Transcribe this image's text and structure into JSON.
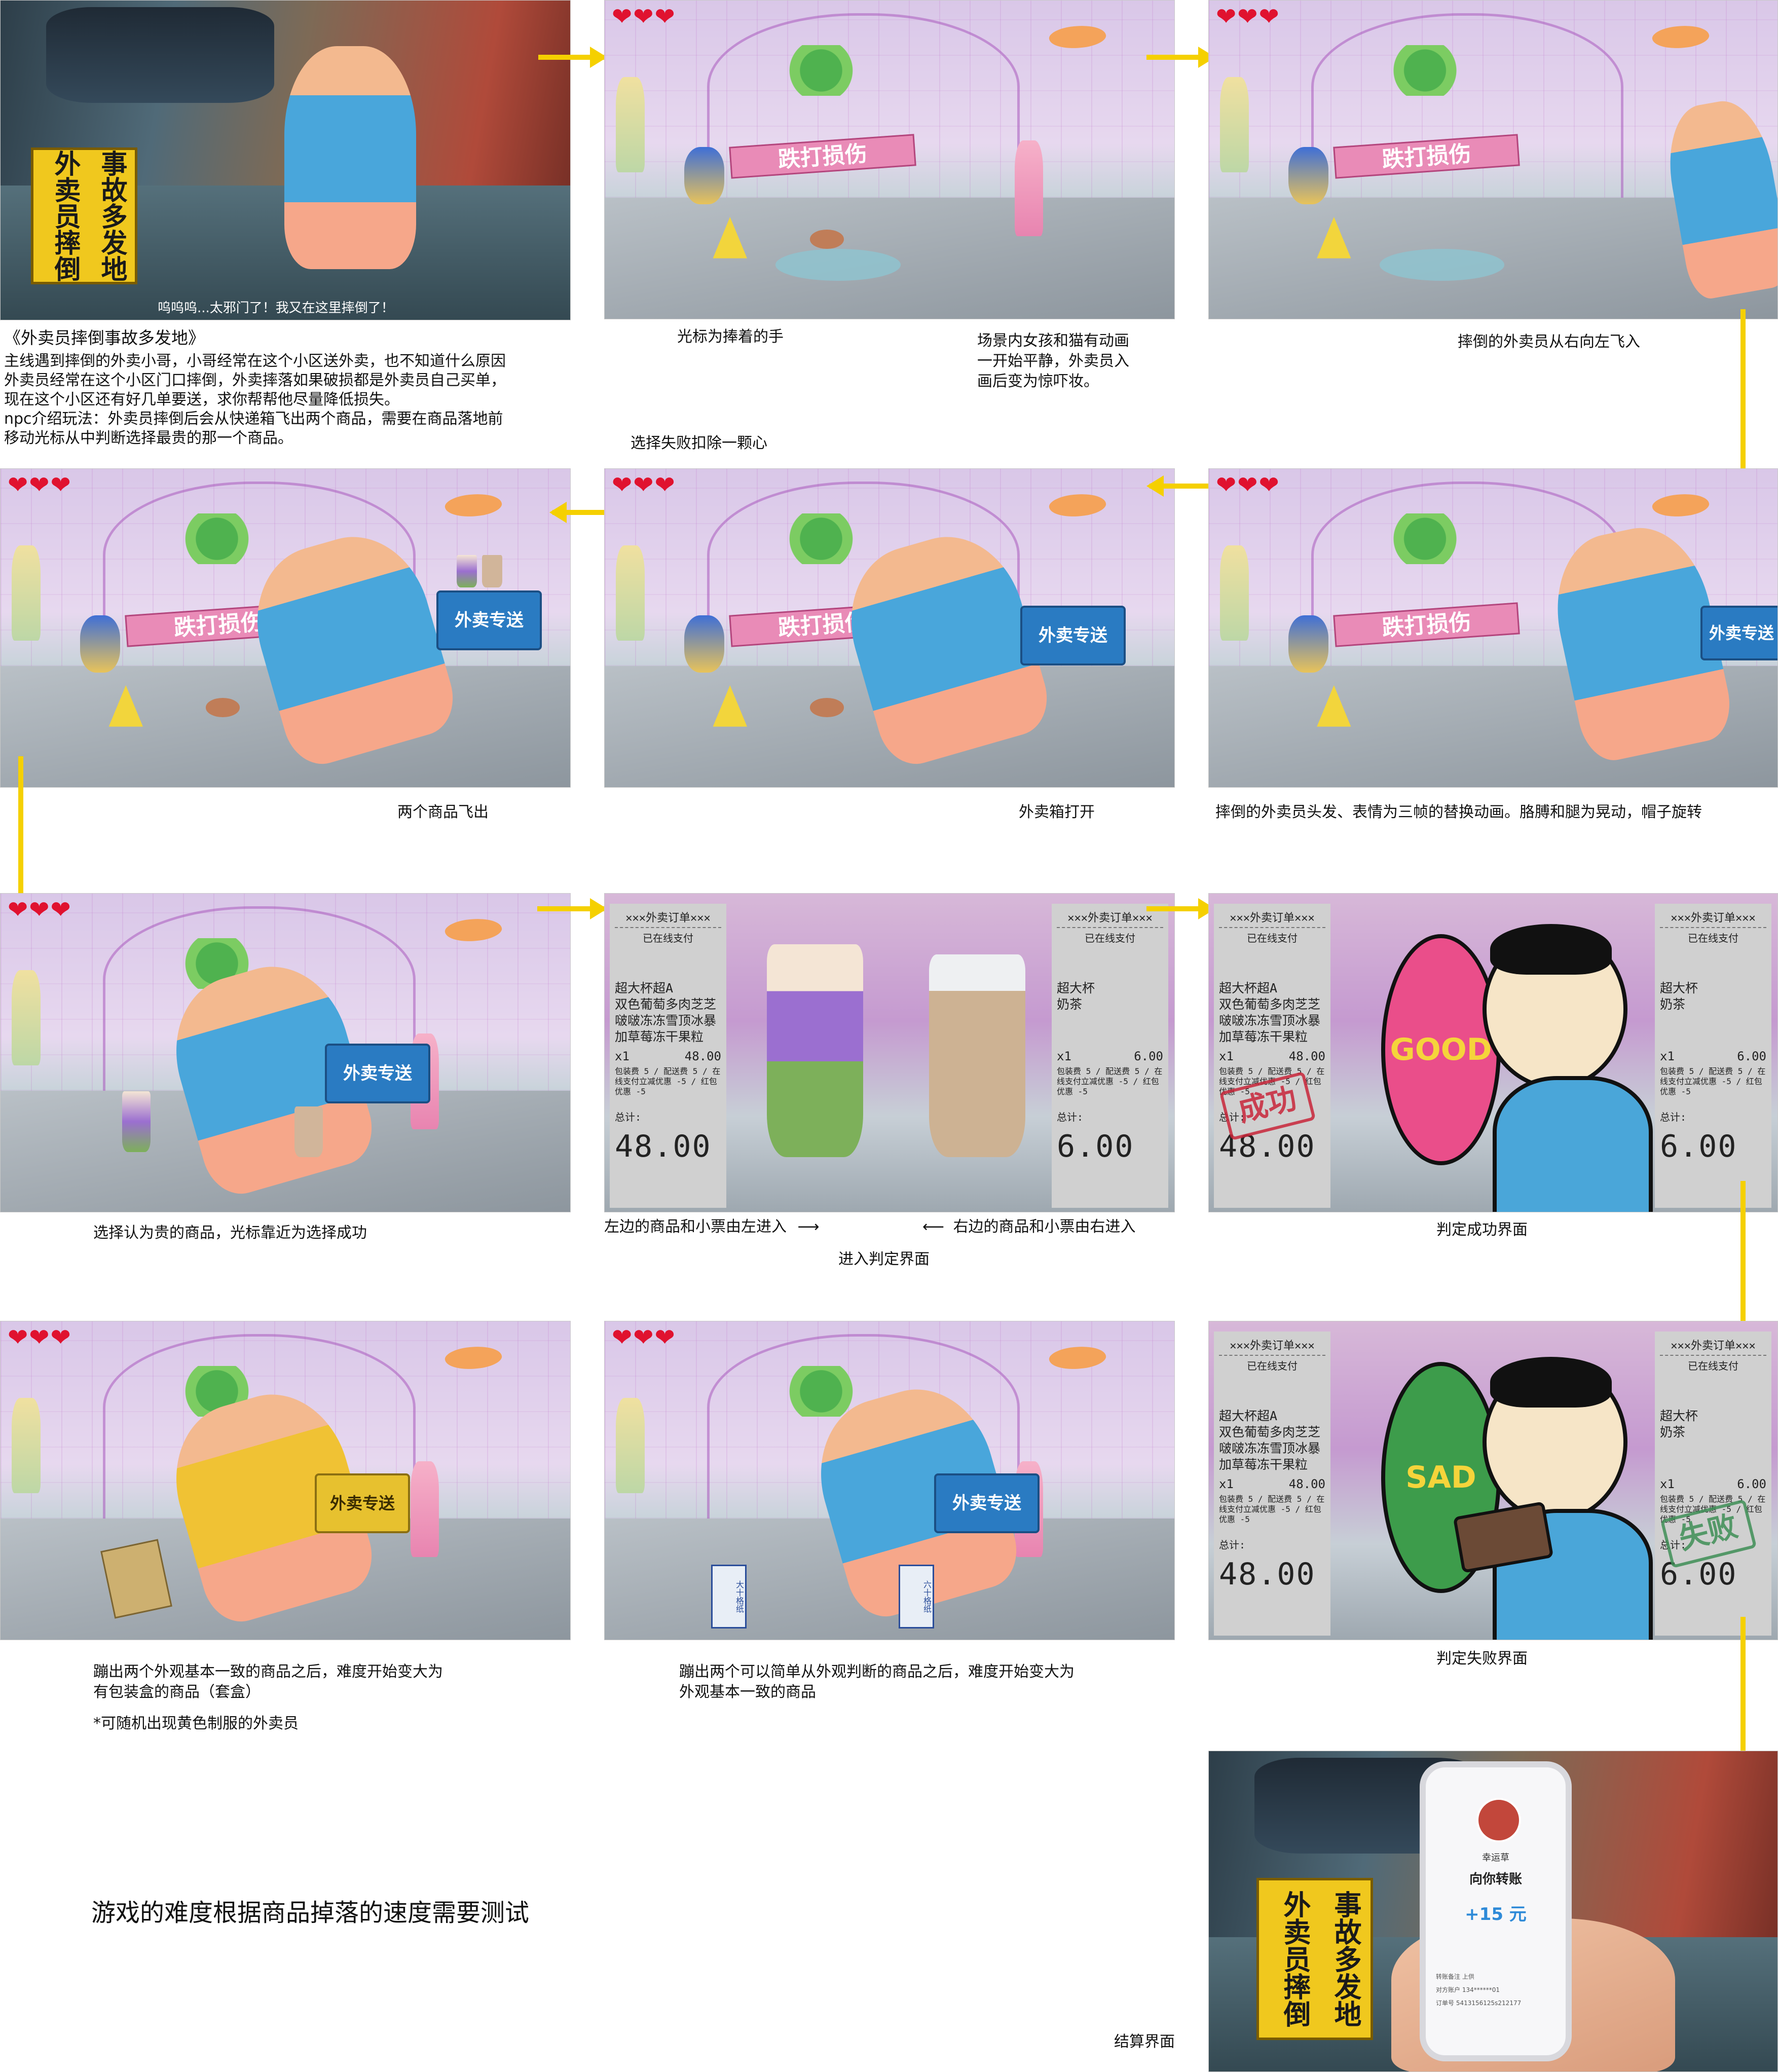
{
  "intro": {
    "title": "《外卖员摔倒事故多发地》",
    "lines": [
      "主线遇到摔倒的外卖小哥，小哥经常在这个小区送外卖，也不知道什么原因",
      "外卖员经常在这个小区门口摔倒，外卖摔落如果破损都是外卖员自己买单，",
      "现在这个小区还有好几单要送，求你帮帮他尽量降低损失。",
      "npc介绍玩法：外卖员摔倒后会从快递箱飞出两个商品，需要在商品落地前",
      "移动光标从中判断选择最贵的那一个商品。"
    ]
  },
  "hearts": "❤❤❤",
  "scene_text": {
    "warning_sign": "事故多发地 外卖员摔倒",
    "warning_sign_a": "外卖员摔倒",
    "warning_sign_b": "事故多发地",
    "shop_sign": "跌打损伤",
    "box_label": "外卖专送",
    "panel1_subtitle": "呜呜呜...太邪门了！我又在这里摔倒了！"
  },
  "captions": {
    "cursor_hand": "光标为捧着的手",
    "fail_minus_heart": "选择失败扣除一颗心",
    "scene_anim_1": "场景内女孩和猫有动画",
    "scene_anim_2": "一开始平静，外卖员入",
    "scene_anim_3": "画后变为惊吓妆。",
    "fly_in": "摔倒的外卖员从右向左飞入",
    "replace_anim": "摔倒的外卖员头发、表情为三帧的替换动画。胳膊和腿为晃动，帽子旋转",
    "box_open": "外卖箱打开",
    "two_items": "两个商品飞出",
    "choose_expensive": "选择认为贵的商品，光标靠近为选择成功",
    "left_enter": "左边的商品和小票由左进入",
    "left_arrow": "⟶",
    "right_arrow": "⟵",
    "right_enter": "右边的商品和小票由右进入",
    "enter_judge": "进入判定界面",
    "judge_success": "判定成功界面",
    "judge_fail": "判定失败界面",
    "harder_box_1": "蹦出两个外观基本一致的商品之后，难度开始变大为",
    "harder_box_2": "有包装盒的商品（套盒）",
    "yellow_note": "*可随机出现黄色制服的外卖员",
    "harder_same_1": "蹦出两个可以简单从外观判断的商品之后，难度开始变大为",
    "harder_same_2": "外观基本一致的商品",
    "difficulty_note": "游戏的难度根据商品掉落的速度需要测试",
    "settlement": "结算界面"
  },
  "receipt_left": {
    "title": "✕✕✕外卖订单✕✕✕",
    "status": "已在线支付",
    "item_lines": [
      "超大杯超A",
      "双色葡萄多肉芝芝",
      "啵啵冻冻雪顶冰暴",
      "加草莓冻干果粒"
    ],
    "qty": "x1",
    "qty_price": "48.00",
    "fees": "包装费 5 / 配送费 5 / 在线支付立减优惠 -5 / 红包优惠 -5",
    "total_label": "总计:",
    "total": "48.00"
  },
  "receipt_right": {
    "title": "✕✕✕外卖订单✕✕✕",
    "status": "已在线支付",
    "item_lines": [
      "超大杯",
      "奶茶"
    ],
    "qty": "x1",
    "qty_price": "6.00",
    "fees": "包装费 5 / 配送费 5 / 在线支付立减优惠 -5 / 红包优惠 -5",
    "total_label": "总计:",
    "total": "6.00"
  },
  "stamps": {
    "success": "成功",
    "fail": "失败"
  },
  "badges": {
    "good": "GOOD",
    "sad": "SAD"
  },
  "packaged": {
    "a": "大十格纸",
    "b": "六十格纸"
  },
  "phone": {
    "name": "幸运草",
    "action": "向你转账",
    "amount": "+15 元",
    "rows": [
      "转账备注  上供",
      "对方账户  134******01",
      "订单号  5413156125s212177"
    ]
  },
  "colors": {
    "arrow": "#f5d000",
    "heart": "#e0122f",
    "box_blue": "#2a7bc2",
    "box_yellow": "#e7c12f",
    "stamp_red": "#c8263a",
    "stamp_green": "#3f8f57"
  }
}
